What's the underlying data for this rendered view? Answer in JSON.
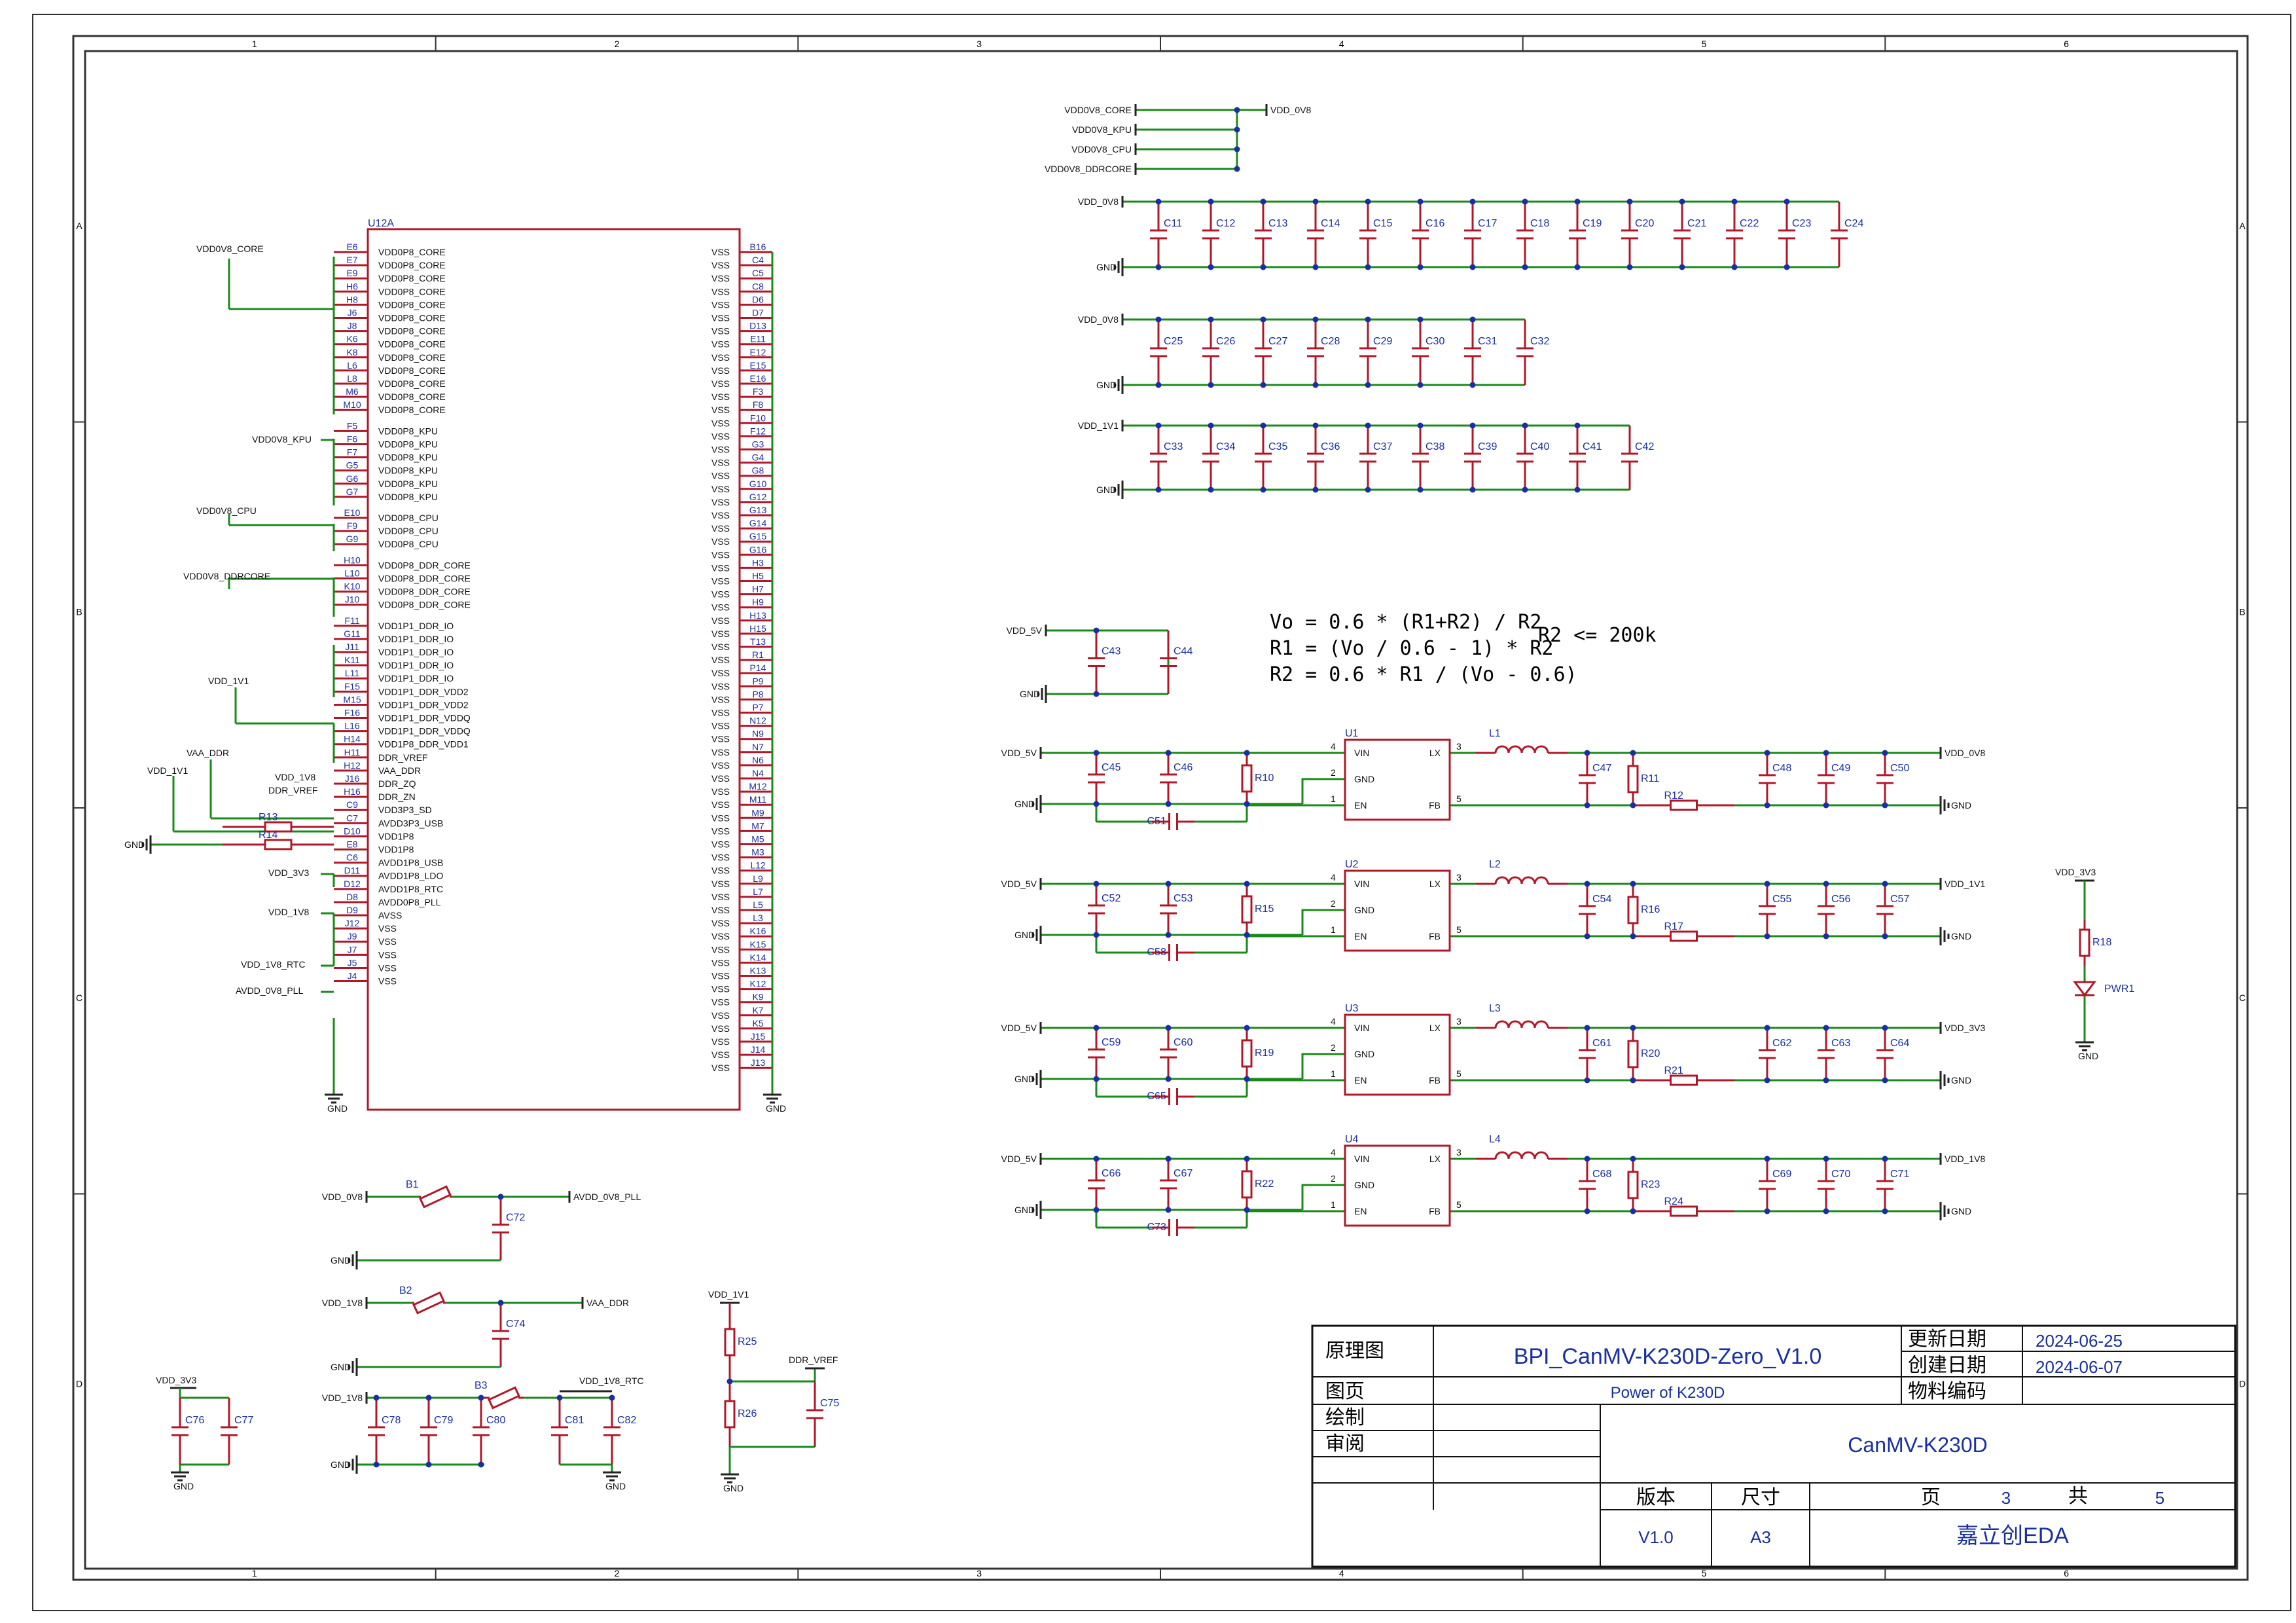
{
  "border": {
    "cols": [
      "1",
      "2",
      "3",
      "4",
      "5",
      "6"
    ],
    "rows": [
      "A",
      "B",
      "C",
      "D"
    ]
  },
  "title_block": {
    "label_schematic": "原理图",
    "project": "BPI_CanMV-K230D-Zero_V1.0",
    "label_updated": "更新日期",
    "updated": "2024-06-25",
    "label_created": "创建日期",
    "created": "2024-06-07",
    "label_page": "图页",
    "page_name": "Power of K230D",
    "label_material": "物料编码",
    "label_drawn": "绘制",
    "label_review": "审阅",
    "board": "CanMV-K230D",
    "label_version": "版本",
    "label_size": "尺寸",
    "label_sheet": "页",
    "sheet_no": "3",
    "label_total": "共",
    "total": "5",
    "version": "V1.0",
    "size": "A3",
    "company": "嘉立创EDA"
  },
  "formulas": {
    "f1": "Vo = 0.6 * (R1+R2) / R2",
    "f1b": "R2 <= 200k",
    "f2": "R1 = (Vo / 0.6 - 1) * R2",
    "f3": "R2 = 0.6 * R1 / (Vo - 0.6)"
  },
  "net_merge": {
    "inputs": [
      "VDD0V8_CORE",
      "VDD0V8_KPU",
      "VDD0V8_CPU",
      "VDD0V8_DDRCORE"
    ],
    "output": "VDD_0V8"
  },
  "cap_banks": [
    {
      "net": "VDD_0V8",
      "gnd": "GND",
      "caps": [
        "C11",
        "C12",
        "C13",
        "C14",
        "C15",
        "C16",
        "C17",
        "C18",
        "C19",
        "C20",
        "C21",
        "C22",
        "C23",
        "C24"
      ]
    },
    {
      "net": "VDD_0V8",
      "gnd": "GND",
      "caps": [
        "C25",
        "C26",
        "C27",
        "C28",
        "C29",
        "C30",
        "C31",
        "C32"
      ]
    },
    {
      "net": "VDD_1V1",
      "gnd": "GND",
      "caps": [
        "C33",
        "C34",
        "C35",
        "C36",
        "C37",
        "C38",
        "C39",
        "C40",
        "C41",
        "C42"
      ]
    }
  ],
  "bulk": {
    "net": "VDD_5V",
    "gnd": "GND",
    "caps": [
      "C43",
      "C44"
    ]
  },
  "regulators": [
    {
      "u": "U1",
      "in": "VDD_5V",
      "out": "VDD_0V8",
      "cin": [
        "C45",
        "C46"
      ],
      "ren": "R10",
      "css": "C51",
      "l": "L1",
      "cff": "C47",
      "r1": "R11",
      "r2": "R12",
      "cout": [
        "C48",
        "C49",
        "C50"
      ]
    },
    {
      "u": "U2",
      "in": "VDD_5V",
      "out": "VDD_1V1",
      "cin": [
        "C52",
        "C53"
      ],
      "ren": "R15",
      "css": "C58",
      "l": "L2",
      "cff": "C54",
      "r1": "R16",
      "r2": "R17",
      "cout": [
        "C55",
        "C56",
        "C57"
      ]
    },
    {
      "u": "U3",
      "in": "VDD_5V",
      "out": "VDD_3V3",
      "cin": [
        "C59",
        "C60"
      ],
      "ren": "R19",
      "css": "C65",
      "l": "L3",
      "cff": "C61",
      "r1": "R20",
      "r2": "R21",
      "cout": [
        "C62",
        "C63",
        "C64"
      ]
    },
    {
      "u": "U4",
      "in": "VDD_5V",
      "out": "VDD_1V8",
      "cin": [
        "C66",
        "C67"
      ],
      "ren": "R22",
      "css": "C73",
      "l": "L4",
      "cff": "C68",
      "r1": "R23",
      "r2": "R24",
      "cout": [
        "C69",
        "C70",
        "C71"
      ]
    }
  ],
  "reg_pins": {
    "vin": "VIN",
    "gnd": "GND",
    "en": "EN",
    "lx": "LX",
    "fb": "FB",
    "gnd_net": "GND"
  },
  "led": {
    "net": "VDD_3V3",
    "r": "R18",
    "d": "PWR1",
    "gnd": "GND"
  },
  "u12a": {
    "ref": "U12A",
    "left_groups": [
      {
        "net": "VDD0V8_CORE",
        "pins": [
          [
            "E6",
            "VDD0P8_CORE"
          ],
          [
            "E7",
            "VDD0P8_CORE"
          ],
          [
            "E9",
            "VDD0P8_CORE"
          ],
          [
            "H6",
            "VDD0P8_CORE"
          ],
          [
            "H8",
            "VDD0P8_CORE"
          ],
          [
            "J6",
            "VDD0P8_CORE"
          ],
          [
            "J8",
            "VDD0P8_CORE"
          ],
          [
            "K6",
            "VDD0P8_CORE"
          ],
          [
            "K8",
            "VDD0P8_CORE"
          ],
          [
            "L6",
            "VDD0P8_CORE"
          ],
          [
            "L8",
            "VDD0P8_CORE"
          ],
          [
            "M6",
            "VDD0P8_CORE"
          ],
          [
            "M10",
            "VDD0P8_CORE"
          ]
        ]
      },
      {
        "net": "VDD0V8_KPU",
        "pins": [
          [
            "F5",
            "VDD0P8_KPU"
          ],
          [
            "F6",
            "VDD0P8_KPU"
          ],
          [
            "F7",
            "VDD0P8_KPU"
          ],
          [
            "G5",
            "VDD0P8_KPU"
          ],
          [
            "G6",
            "VDD0P8_KPU"
          ],
          [
            "G7",
            "VDD0P8_KPU"
          ]
        ]
      },
      {
        "net": "VDD0V8_CPU",
        "pins": [
          [
            "E10",
            "VDD0P8_CPU"
          ],
          [
            "F9",
            "VDD0P8_CPU"
          ],
          [
            "G9",
            "VDD0P8_CPU"
          ]
        ]
      },
      {
        "net": "VDD0V8_DDRCORE",
        "pins": [
          [
            "H10",
            "VDD0P8_DDR_CORE"
          ],
          [
            "L10",
            "VDD0P8_DDR_CORE"
          ],
          [
            "K10",
            "VDD0P8_DDR_CORE"
          ],
          [
            "J10",
            "VDD0P8_DDR_CORE"
          ]
        ]
      },
      {
        "net": "VDD_1V1",
        "pins": [
          [
            "F11",
            "VDD1P1_DDR_IO"
          ],
          [
            "G11",
            "VDD1P1_DDR_IO"
          ],
          [
            "J11",
            "VDD1P1_DDR_IO"
          ],
          [
            "K11",
            "VDD1P1_DDR_IO"
          ],
          [
            "L11",
            "VDD1P1_DDR_IO"
          ],
          [
            "F15",
            "VDD1P1_DDR_VDD2"
          ],
          [
            "M15",
            "VDD1P1_DDR_VDD2"
          ],
          [
            "F16",
            "VDD1P1_DDR_VDDQ"
          ],
          [
            "L16",
            "VDD1P1_DDR_VDDQ"
          ],
          [
            "H14",
            "VDD1P8_DDR_VDD1"
          ],
          [
            "H11",
            "DDR_VREF"
          ],
          [
            "H12",
            "VAA_DDR"
          ],
          [
            "J16",
            "DDR_ZQ"
          ],
          [
            "H16",
            "DDR_ZN"
          ],
          [
            "C9",
            "VDD3P3_SD"
          ],
          [
            "C7",
            "AVDD3P3_USB"
          ],
          [
            "D10",
            "VDD1P8"
          ],
          [
            "E8",
            "VDD1P8"
          ],
          [
            "C6",
            "AVDD1P8_USB"
          ],
          [
            "D11",
            "AVDD1P8_LDO"
          ],
          [
            "D12",
            "AVDD1P8_RTC"
          ],
          [
            "D8",
            "AVDD0P8_PLL"
          ],
          [
            "D9",
            "AVSS"
          ],
          [
            "J12",
            "VSS"
          ],
          [
            "J9",
            "VSS"
          ],
          [
            "J7",
            "VSS"
          ],
          [
            "J5",
            "VSS"
          ],
          [
            "J4",
            "VSS"
          ]
        ]
      }
    ],
    "extra_nets": {
      "vdd1v8": "VDD_1V8",
      "ddrvref": "DDR_VREF",
      "vaa": "VAA_DDR",
      "vdd1v1b": "VDD_1V1",
      "r13": "R13",
      "r14": "R14",
      "gnd": "GND",
      "v33": "VDD_3V3",
      "v18": "VDD_1V8",
      "rtc": "VDD_1V8_RTC",
      "pll": "AVDD_0V8_PLL"
    },
    "right_pins": [
      "B16",
      "C4",
      "C5",
      "C8",
      "D6",
      "D7",
      "D13",
      "E11",
      "E12",
      "E15",
      "E16",
      "F3",
      "F8",
      "F10",
      "F12",
      "G3",
      "G4",
      "G8",
      "G10",
      "G12",
      "G13",
      "G14",
      "G15",
      "G16",
      "H3",
      "H5",
      "H7",
      "H9",
      "H13",
      "H15",
      "T13",
      "R1",
      "P14",
      "P9",
      "P8",
      "P7",
      "N12",
      "N9",
      "N7",
      "N6",
      "N4",
      "M12",
      "M11",
      "M9",
      "M7",
      "M5",
      "M3",
      "L12",
      "L9",
      "L7",
      "L5",
      "L3",
      "K16",
      "K15",
      "K14",
      "K13",
      "K12",
      "K9",
      "K7",
      "K5",
      "J15",
      "J14",
      "J13"
    ],
    "right_name": "VSS"
  },
  "bottom": {
    "b1": {
      "ref": "B1",
      "in": "VDD_0V8",
      "out": "AVDD_0V8_PLL",
      "cap": "C72",
      "gnd": "GND"
    },
    "b2": {
      "ref": "B2",
      "in": "VDD_1V8",
      "out": "VAA_DDR",
      "cap": "C74",
      "gnd": "GND"
    },
    "b3": {
      "ref": "B3",
      "in": "VDD_1V8",
      "out": "VDD_1V8_RTC",
      "caps_in": [
        "C78",
        "C79",
        "C80"
      ],
      "caps_out": [
        "C81",
        "C82"
      ],
      "gnd": "GND"
    },
    "v33": {
      "net": "VDD_3V3",
      "caps": [
        "C76",
        "C77"
      ],
      "gnd": "GND"
    },
    "vref": {
      "net": "VDD_1V1",
      "out": "DDR_VREF",
      "r_top": "R25",
      "r_bot": "R26",
      "cap": "C75",
      "gnd": "GND"
    }
  }
}
